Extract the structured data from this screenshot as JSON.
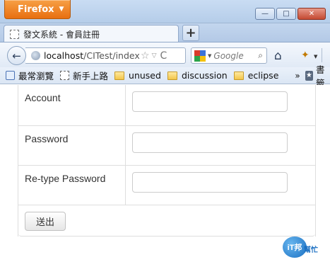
{
  "window": {
    "menu_button": "Firefox",
    "controls": {
      "minimize": "—",
      "maximize": "□",
      "close": "✕"
    }
  },
  "tab": {
    "title": "發文系統 - 會員註冊",
    "new_tab": "+"
  },
  "nav": {
    "back": "←",
    "url_host": "localhost",
    "url_path": "/CITest/index.p",
    "bookmark_star": "☆",
    "url_dropdown": "▽",
    "reload": "C",
    "search_placeholder": "Google",
    "search_icon": "⌕",
    "home": "⌂",
    "addon": "✦"
  },
  "bookmarks": {
    "items": [
      {
        "label": "最常瀏覽",
        "icon": "search-page-icon"
      },
      {
        "label": "新手上路",
        "icon": "page-icon"
      },
      {
        "label": "unused",
        "icon": "folder-icon"
      },
      {
        "label": "discussion",
        "icon": "folder-icon"
      },
      {
        "label": "eclipse",
        "icon": "folder-icon"
      }
    ],
    "more": "»",
    "bookmarks_menu": "書籤"
  },
  "form": {
    "fields": [
      {
        "label": "Account",
        "value": ""
      },
      {
        "label": "Password",
        "value": ""
      },
      {
        "label": "Re-type Password",
        "value": ""
      }
    ],
    "submit_label": "送出"
  },
  "watermark": {
    "badge": "iT邦",
    "text": "幫忙"
  }
}
